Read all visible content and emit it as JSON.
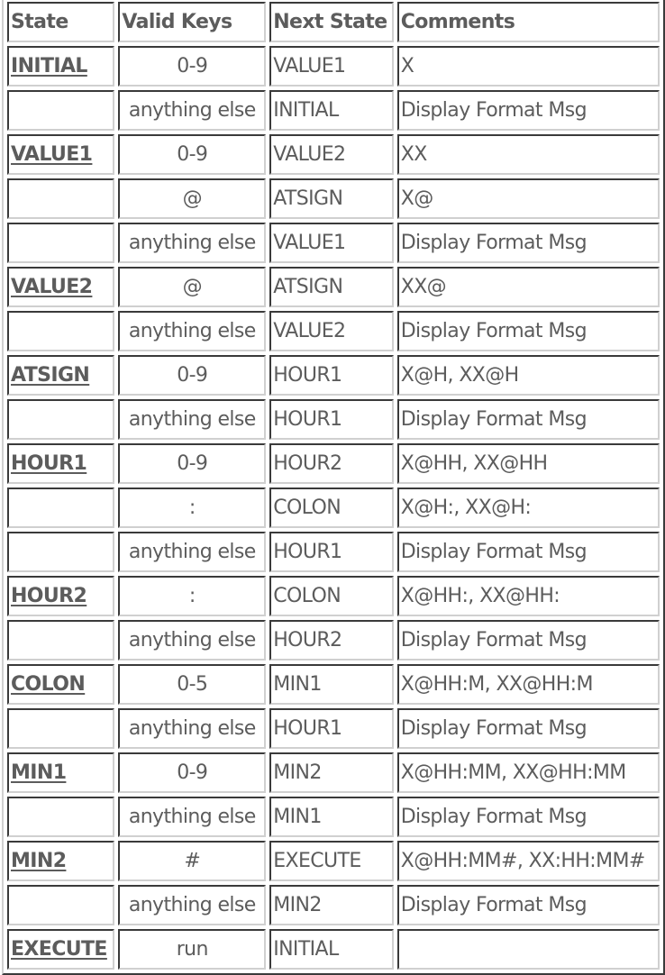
{
  "headers": {
    "state": "State",
    "valid_keys": "Valid Keys",
    "next_state": "Next State",
    "comments": "Comments"
  },
  "rows": [
    {
      "state": "INITIAL",
      "keys": "0-9",
      "next": "VALUE1",
      "comment": "X"
    },
    {
      "state": "",
      "keys": "anything else",
      "next": "INITIAL",
      "comment": "Display Format Msg"
    },
    {
      "state": "VALUE1",
      "keys": "0-9",
      "next": "VALUE2",
      "comment": "XX"
    },
    {
      "state": "",
      "keys": "@",
      "next": "ATSIGN",
      "comment": "X@"
    },
    {
      "state": "",
      "keys": "anything else",
      "next": "VALUE1",
      "comment": "Display Format Msg"
    },
    {
      "state": "VALUE2",
      "keys": "@",
      "next": "ATSIGN",
      "comment": "XX@"
    },
    {
      "state": "",
      "keys": "anything else",
      "next": "VALUE2",
      "comment": "Display Format Msg"
    },
    {
      "state": "ATSIGN",
      "keys": "0-9",
      "next": "HOUR1",
      "comment": "X@H, XX@H"
    },
    {
      "state": "",
      "keys": "anything else",
      "next": "HOUR1",
      "comment": "Display Format Msg"
    },
    {
      "state": "HOUR1",
      "keys": "0-9",
      "next": "HOUR2",
      "comment": "X@HH, XX@HH"
    },
    {
      "state": "",
      "keys": ":",
      "next": "COLON",
      "comment": "X@H:, XX@H:"
    },
    {
      "state": "",
      "keys": "anything else",
      "next": "HOUR1",
      "comment": "Display Format Msg"
    },
    {
      "state": "HOUR2",
      "keys": ":",
      "next": "COLON",
      "comment": "X@HH:, XX@HH:"
    },
    {
      "state": "",
      "keys": "anything else",
      "next": "HOUR2",
      "comment": "Display Format Msg"
    },
    {
      "state": "COLON",
      "keys": "0-5",
      "next": "MIN1",
      "comment": "X@HH:M, XX@HH:M"
    },
    {
      "state": "",
      "keys": "anything else",
      "next": "HOUR1",
      "comment": "Display Format Msg"
    },
    {
      "state": "MIN1",
      "keys": "0-9",
      "next": "MIN2",
      "comment": "X@HH:MM, XX@HH:MM"
    },
    {
      "state": "",
      "keys": "anything else",
      "next": "MIN1",
      "comment": "Display Format Msg"
    },
    {
      "state": "MIN2",
      "keys": "#",
      "next": "EXECUTE",
      "comment": "X@HH:MM#, XX:HH:MM#"
    },
    {
      "state": "",
      "keys": "anything else",
      "next": "MIN2",
      "comment": "Display Format Msg"
    },
    {
      "state": "EXECUTE",
      "keys": "run",
      "next": "INITIAL",
      "comment": ""
    }
  ],
  "colors": {
    "text": "#5c5c5c",
    "border_dark": "#3a3a3a",
    "border_light": "#d0d0d0"
  }
}
